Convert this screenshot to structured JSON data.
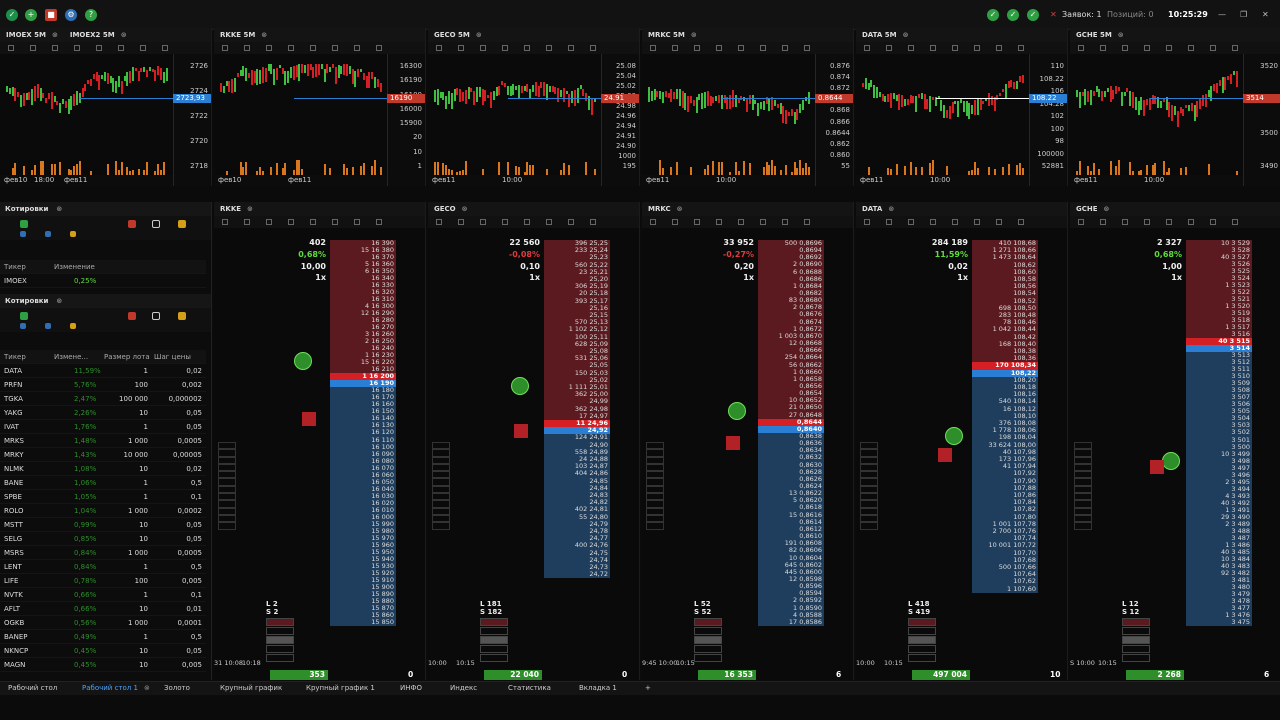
{
  "app": {
    "status_blocked": "Заявок: 1",
    "status_positions": "Позиций: 0",
    "clock": "10:25:29",
    "colors": {
      "accent": "#4aa3ff",
      "ask": "#5a1a1f",
      "bid": "#1f3d5c",
      "buy": "#5fdc3b",
      "sell": "#e23a3a",
      "volume": "#d9771f"
    }
  },
  "charts": [
    {
      "title": "IMOEX 5M",
      "title2": "IMOEX2 5M",
      "prices": [
        "2726",
        "2724",
        "2722",
        "2720",
        "2718"
      ],
      "last": "2723,93",
      "date_labels": [
        "фев10",
        "18:00",
        "фев11"
      ]
    },
    {
      "title": "RKKE 5M",
      "prices": [
        "16300",
        "16190",
        "16100",
        "16000",
        "15900",
        "20",
        "10",
        "1"
      ],
      "last": "16190",
      "date_labels": [
        "фев10",
        "фев11"
      ]
    },
    {
      "title": "GECO 5M",
      "prices": [
        "25.08",
        "25.04",
        "25.02",
        "25.00",
        "24.98",
        "24.96",
        "24.94",
        "24.91",
        "24.90",
        "1000",
        "195"
      ],
      "last": "24.91",
      "date_labels": [
        "фев11",
        "10:00"
      ]
    },
    {
      "title": "MRKC 5M",
      "prices": [
        "0.876",
        "0.874",
        "0.872",
        "0.870",
        "0.868",
        "0.866",
        "0.8644",
        "0.862",
        "0.860",
        "55"
      ],
      "last": "0.8644",
      "date_labels": [
        "фев11",
        "10:00"
      ]
    },
    {
      "title": "DATA 5M",
      "prices": [
        "110",
        "108.22",
        "106",
        "104.28",
        "102",
        "100",
        "98",
        "100000",
        "52881"
      ],
      "last": "108.22",
      "date_labels": [
        "фев11",
        "10:00"
      ]
    },
    {
      "title": "GCHE 5M",
      "prices": [
        "3520",
        "3514",
        "3500",
        "3490"
      ],
      "last": "3514",
      "date_labels": [
        "фев11",
        "10:00"
      ]
    }
  ],
  "watchlist_small": {
    "title": "Котировки",
    "headers": [
      "Тикер",
      "Изменение"
    ],
    "rows": [
      {
        "ticker": "IMOEX",
        "change": "0,25%"
      }
    ]
  },
  "watchlist": {
    "title": "Котировки",
    "headers": [
      "Тикер",
      "Измене...",
      "Размер лота",
      "Шаг цены"
    ],
    "rows": [
      {
        "ticker": "DATA",
        "change": "11,59%",
        "lot": "1",
        "step": "0,02"
      },
      {
        "ticker": "PRFN",
        "change": "5,76%",
        "lot": "100",
        "step": "0,002"
      },
      {
        "ticker": "TGKA",
        "change": "2,47%",
        "lot": "100 000",
        "step": "0,000002"
      },
      {
        "ticker": "YAKG",
        "change": "2,26%",
        "lot": "10",
        "step": "0,05"
      },
      {
        "ticker": "IVAT",
        "change": "1,76%",
        "lot": "1",
        "step": "0,05"
      },
      {
        "ticker": "MRKS",
        "change": "1,48%",
        "lot": "1 000",
        "step": "0,0005"
      },
      {
        "ticker": "MRKY",
        "change": "1,43%",
        "lot": "10 000",
        "step": "0,00005"
      },
      {
        "ticker": "NLMK",
        "change": "1,08%",
        "lot": "10",
        "step": "0,02"
      },
      {
        "ticker": "BANE",
        "change": "1,06%",
        "lot": "1",
        "step": "0,5"
      },
      {
        "ticker": "SPBE",
        "change": "1,05%",
        "lot": "1",
        "step": "0,1"
      },
      {
        "ticker": "ROLO",
        "change": "1,04%",
        "lot": "1 000",
        "step": "0,0002"
      },
      {
        "ticker": "MSTT",
        "change": "0,99%",
        "lot": "10",
        "step": "0,05"
      },
      {
        "ticker": "SELG",
        "change": "0,85%",
        "lot": "10",
        "step": "0,05"
      },
      {
        "ticker": "MSRS",
        "change": "0,84%",
        "lot": "1 000",
        "step": "0,0005"
      },
      {
        "ticker": "LENT",
        "change": "0,84%",
        "lot": "1",
        "step": "0,5"
      },
      {
        "ticker": "LIFE",
        "change": "0,78%",
        "lot": "100",
        "step": "0,005"
      },
      {
        "ticker": "NVTK",
        "change": "0,66%",
        "lot": "1",
        "step": "0,1"
      },
      {
        "ticker": "AFLT",
        "change": "0,66%",
        "lot": "10",
        "step": "0,01"
      },
      {
        "ticker": "OGKB",
        "change": "0,56%",
        "lot": "1 000",
        "step": "0,0001"
      },
      {
        "ticker": "BANEP",
        "change": "0,49%",
        "lot": "1",
        "step": "0,5"
      },
      {
        "ticker": "NKNCP",
        "change": "0,45%",
        "lot": "10",
        "step": "0,05"
      },
      {
        "ticker": "MAGN",
        "change": "0,45%",
        "lot": "10",
        "step": "0,005"
      }
    ]
  },
  "orderbooks": [
    {
      "title": "RKKE",
      "volume": "402",
      "change": "0,68%",
      "price": "10,00",
      "mult": "1x",
      "l_label": "L 2",
      "s_label": "S 2",
      "bottom_total": "353",
      "bottom_right": "0",
      "time1": "31 10:08",
      "time2": "10:18",
      "asks": [
        "16 390",
        "15 16 380",
        "16 370",
        "5 16 360",
        "6 16 350",
        "16 340",
        "16 330",
        "16 320",
        "16 310",
        "4 16 300",
        "12 16 290",
        "16 280",
        "16 270",
        "3 16 260",
        "2 16 250",
        "16 240",
        "1 16 230",
        "15 16 220",
        "16 210"
      ],
      "best_ask": "1 16 200",
      "bids": [
        "16 190",
        "16 180",
        "16 170",
        "16 160",
        "16 150",
        "16 140",
        "16 130",
        "16 120",
        "16 110",
        "16 100",
        "16 090",
        "16 080",
        "16 070",
        "16 060",
        "16 050",
        "16 040",
        "16 030",
        "16 020",
        "16 010",
        "16 000",
        "15 990",
        "15 980",
        "15 970",
        "15 960",
        "15 950",
        "15 940",
        "15 930",
        "15 920",
        "15 910",
        "15 900",
        "15 890",
        "15 880",
        "15 870",
        "15 860",
        "15 850"
      ]
    },
    {
      "title": "GECO",
      "volume": "22 560",
      "change": "-0,08%",
      "price": "0,10",
      "mult": "1x",
      "l_label": "L 181",
      "s_label": "S 182",
      "bottom_total": "22 040",
      "bottom_right": "0",
      "time1": "10:00",
      "time2": "10:15",
      "asks": [
        "396 25,25",
        "233 25,24",
        "25,23",
        "560 25,22",
        "23 25,21",
        "25,20",
        "306 25,19",
        "20 25,18",
        "393 25,17",
        "25,16",
        "25,15",
        "570 25,13",
        "1 102 25,12",
        "100 25,11",
        "628 25,09",
        "25,08",
        "531 25,06",
        "25,05",
        "150 25,03",
        "25,02",
        "1 111 25,01",
        "362 25,00",
        "24,99",
        "362 24,98",
        "17 24,97"
      ],
      "best_ask": "11 24,96",
      "bids": [
        "24,92",
        "124 24,91",
        "24,90",
        "558 24,89",
        "24 24,88",
        "103 24,87",
        "404 24,86",
        "24,85",
        "24,84",
        "24,83",
        "24,82",
        "402 24,81",
        "55 24,80",
        "24,79",
        "24,78",
        "24,77",
        "400 24,76",
        "24,75",
        "24,74",
        "24,73",
        "24,72"
      ]
    },
    {
      "title": "MRKC",
      "volume": "33 952",
      "change": "-0,27%",
      "price": "0,20",
      "mult": "1x",
      "l_label": "L 52",
      "s_label": "S 52",
      "bottom_total": "16 353",
      "bottom_right": "6",
      "time1": "9:45 10:00",
      "time2": "10:15",
      "asks": [
        "500 0,8696",
        "0,8694",
        "0,8692",
        "2 0,8690",
        "6 0,8688",
        "0,8686",
        "1 0,8684",
        "0,8682",
        "83 0,8680",
        "2 0,8678",
        "0,8676",
        "0,8674",
        "1 0,8672",
        "1 003 0,8670",
        "12 0,8668",
        "0,8666",
        "254 0,8664",
        "56 0,8662",
        "1 0,8660",
        "1 0,8658",
        "0,8656",
        "0,8654",
        "10 0,8652",
        "21 0,8650",
        "27 0,8648"
      ],
      "best_ask": "0,8644",
      "bids": [
        "0,8640",
        "0,8638",
        "0,8636",
        "0,8634",
        "0,8632",
        "0,8630",
        "0,8628",
        "0,8626",
        "0,8624",
        "13 0,8622",
        "5 0,8620",
        "0,8618",
        "15 0,8616",
        "0,8614",
        "0,8612",
        "0,8610",
        "191 0,8608",
        "82 0,8606",
        "10 0,8604",
        "645 0,8602",
        "445 0,8600",
        "12 0,8598",
        "0,8596",
        "0,8594",
        "2 0,8592",
        "1 0,8590",
        "4 0,8588",
        "17 0,8586"
      ]
    },
    {
      "title": "DATA",
      "volume": "284 189",
      "change": "11,59%",
      "price": "0,02",
      "mult": "1x",
      "l_label": "L 418",
      "s_label": "S 419",
      "bottom_total": "497 004",
      "bottom_right": "10",
      "time1": "10:00",
      "time2": "10:15",
      "asks": [
        "410 108,68",
        "1 271 108,66",
        "1 473 108,64",
        "108,62",
        "108,60",
        "108,58",
        "108,56",
        "108,54",
        "108,52",
        "698 108,50",
        "283 108,48",
        "78 108,46",
        "1 042 108,44",
        "108,42",
        "168 108,40",
        "108,38",
        "108,36"
      ],
      "best_ask": "170 108,34",
      "bids": [
        "108,22",
        "108,20",
        "108,18",
        "108,16",
        "540 108,14",
        "16 108,12",
        "108,10",
        "376 108,08",
        "1 778 108,06",
        "198 108,04",
        "33 624 108,00",
        "40 107,98",
        "173 107,96",
        "41 107,94",
        "107,92",
        "107,90",
        "107,88",
        "107,86",
        "107,84",
        "107,82",
        "107,80",
        "1 001 107,78",
        "2 700 107,76",
        "107,74",
        "10 001 107,72",
        "107,70",
        "107,68",
        "500 107,66",
        "107,64",
        "107,62",
        "1 107,60"
      ]
    },
    {
      "title": "GCHE",
      "volume": "2 327",
      "change": "0,68%",
      "price": "1,00",
      "mult": "1x",
      "l_label": "L 12",
      "s_label": "S 12",
      "bottom_total": "2 268",
      "bottom_right": "6",
      "time1": "S 10:00",
      "time2": "10:15",
      "asks": [
        "10 3 529",
        "3 528",
        "40 3 527",
        "3 526",
        "3 525",
        "3 524",
        "1 3 523",
        "3 522",
        "3 521",
        "1 3 520",
        "3 519",
        "3 518",
        "1 3 517",
        "3 516"
      ],
      "best_ask": "40 3 515",
      "bids": [
        "3 514",
        "3 513",
        "3 512",
        "3 511",
        "3 510",
        "3 509",
        "3 508",
        "3 507",
        "3 506",
        "3 505",
        "3 504",
        "3 503",
        "3 502",
        "3 501",
        "3 500",
        "10 3 499",
        "3 498",
        "3 497",
        "3 496",
        "2 3 495",
        "3 494",
        "4 3 493",
        "40 3 492",
        "1 3 491",
        "29 3 490",
        "2 3 489",
        "3 488",
        "3 487",
        "1 3 486",
        "40 3 485",
        "10 3 484",
        "40 3 483",
        "92 3 482",
        "3 481",
        "3 480",
        "3 479",
        "3 478",
        "3 477",
        "1 3 476",
        "3 475"
      ]
    }
  ],
  "taskbar": {
    "tabs": [
      "Рабочий стол",
      "Рабочий стол 1",
      "Золото",
      "Крупный график",
      "Крупный график 1",
      "ИНФО",
      "Индекс",
      "Статистика",
      "Вкладка 1",
      "+"
    ]
  }
}
